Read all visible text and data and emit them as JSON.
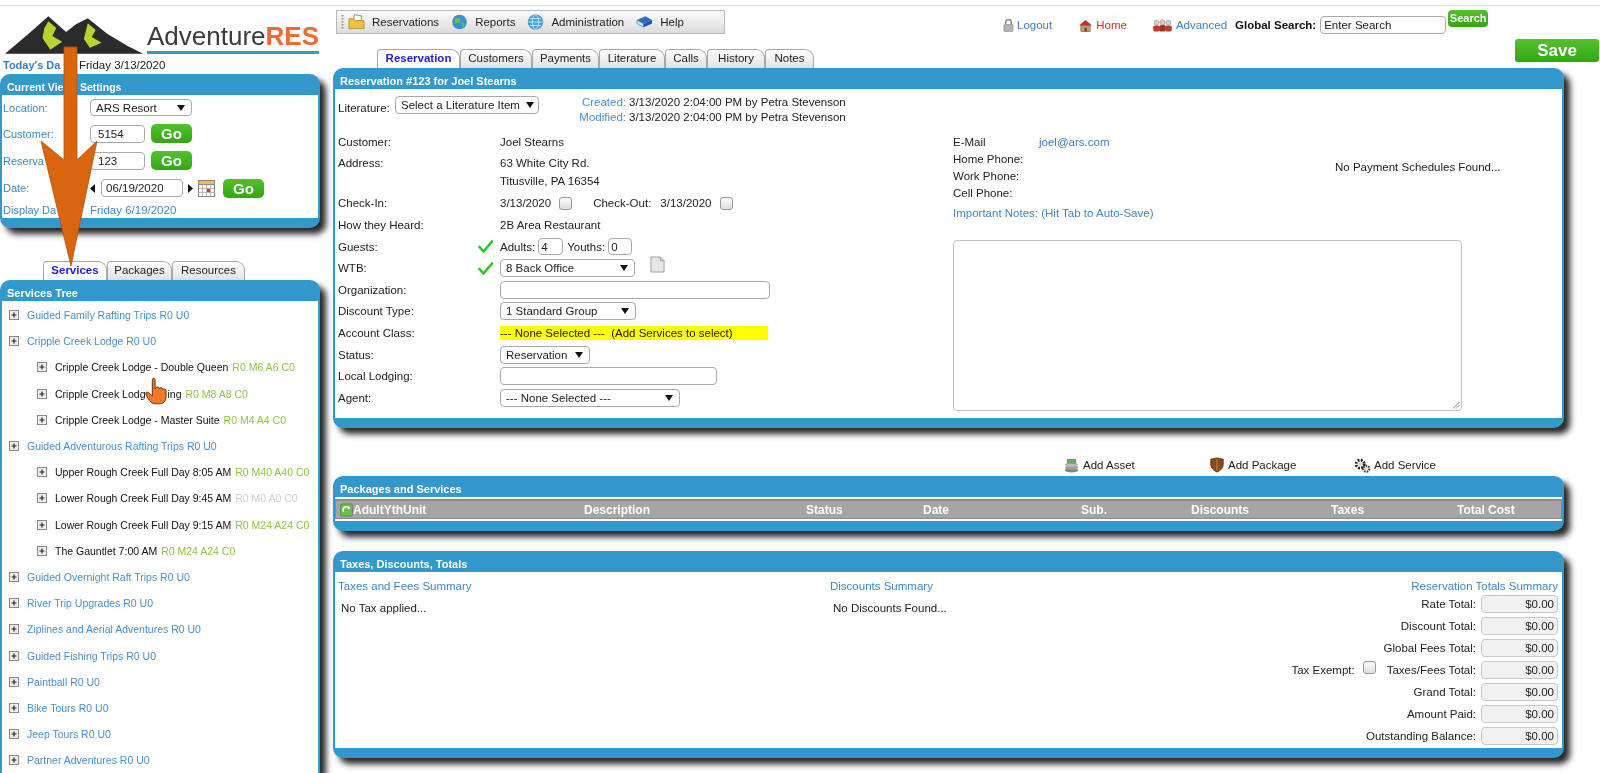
{
  "logo": {
    "wordmark": "Adventure**RES**"
  },
  "today": {
    "label": "Today's Da",
    "value": "Friday 3/13/2020"
  },
  "view_settings": {
    "title": "Current Vie",
    "title_tail": "Settings",
    "fields": [
      {
        "kind": "select",
        "label": "Location:",
        "value": "ARS Resort"
      },
      {
        "kind": "input_go",
        "label": "Customer:",
        "value": "5154",
        "button": "Go"
      },
      {
        "kind": "input_go",
        "label": "Reserva",
        "value": "123",
        "button": "Go"
      },
      {
        "kind": "date",
        "label": "Date:",
        "value": "06/19/2020",
        "button": "Go"
      },
      {
        "kind": "text",
        "label": "Display Da",
        "value": "Friday 6/19/2020"
      }
    ]
  },
  "side_tabs": [
    {
      "label": "Services",
      "selected": true
    },
    {
      "label": "Packages",
      "selected": false
    },
    {
      "label": "Resources",
      "selected": false
    }
  ],
  "services_tree": {
    "title": "Services Tree",
    "items": [
      {
        "label": "Guided Family Rafting Trips R0 U0"
      },
      {
        "label": "Cripple Creek Lodge R0 U0",
        "children": [
          {
            "label": "Cripple Creek Lodge - Double Queen",
            "counts": "R0 M6 A6 C0",
            "color": "#8dc63f"
          },
          {
            "label": "Cripple Creek Lodg",
            "label_tail": "ing",
            "counts": "R0 M8 A8 C0",
            "color": "#8dc63f"
          },
          {
            "label": "Cripple Creek Lodge - Master Suite",
            "counts": "R0 M4 A4 C0",
            "color": "#8dc63f"
          }
        ]
      },
      {
        "label": "Guided Adventurous Rafting Trips R0 U0",
        "children": [
          {
            "label": "Upper Rough Creek Full Day 8:05 AM",
            "counts": "R0 M40 A40 C0",
            "color": "#8dc63f"
          },
          {
            "label": "Lower Rough Creek Full Day 9:45 AM",
            "counts": "R0 M0 A0 C0",
            "color": "#cfcfcf"
          },
          {
            "label": "Lower Rough Creek Full Day 9:15 AM",
            "counts": "R0 M24 A24 C0",
            "color": "#8dc63f"
          },
          {
            "label": "The Gauntlet 7:00 AM",
            "counts": "R0 M24 A24 C0",
            "color": "#8dc63f"
          }
        ]
      },
      {
        "label": "Guided Overnight Raft Trips R0 U0"
      },
      {
        "label": "River Trip Upgrades R0 U0"
      },
      {
        "label": "Ziplines and Aerial Adventures R0 U0"
      },
      {
        "label": "Guided Fishing Trips R0 U0"
      },
      {
        "label": "Paintball R0 U0"
      },
      {
        "label": "Bike Tours R0 U0"
      },
      {
        "label": "Jeep Tours R0 U0"
      },
      {
        "label": "Partner Adventures R0 U0"
      }
    ]
  },
  "main_menu": [
    {
      "label": "Reservations"
    },
    {
      "label": "Reports"
    },
    {
      "label": "Administration"
    },
    {
      "label": "Help"
    }
  ],
  "top_links": [
    {
      "label": "Logout",
      "color": "#3a7fc4"
    },
    {
      "label": "Home",
      "color": "#e8281e"
    },
    {
      "label": "Advanced",
      "color": "#3a7fc4"
    }
  ],
  "global_search": {
    "label": "Global Search:",
    "value": "Enter Search",
    "button": "Search"
  },
  "save_button": "Save",
  "main_tabs": [
    {
      "label": "Reservation",
      "selected": true
    },
    {
      "label": "Customers",
      "selected": false
    },
    {
      "label": "Payments",
      "selected": false
    },
    {
      "label": "Literature",
      "selected": false
    },
    {
      "label": "Calls",
      "selected": false
    },
    {
      "label": "History",
      "selected": false
    },
    {
      "label": "Notes",
      "selected": false
    }
  ],
  "reservation": {
    "title": "Reservation #123 for Joel Stearns",
    "literature": {
      "label": "Literature:",
      "value": "Select a Literature Item"
    },
    "audit": [
      {
        "label": "Created:",
        "value": "3/13/2020 2:04:00 PM by Petra Stevenson"
      },
      {
        "label": "Modified:",
        "value": "3/13/2020 2:04:00 PM by Petra Stevenson"
      }
    ],
    "fields": [
      {
        "kind": "text",
        "label": "Customer:",
        "value": "Joel Stearns"
      },
      {
        "kind": "lines",
        "label": "Address:",
        "lines": [
          "63 White City Rd.",
          "Titusville, PA 16354"
        ]
      },
      {
        "kind": "checkdates",
        "label": "Check-In:",
        "value": "3/13/2020",
        "checked": false,
        "second_label": "Check-Out:",
        "second_value": "3/13/2020",
        "second_checked": false
      },
      {
        "kind": "text",
        "label": "How they Heard:",
        "value": "2B Area Restaurant"
      },
      {
        "kind": "guests",
        "label": "Guests:",
        "valid": true,
        "adults_label": "Adults:",
        "adults": "4",
        "youths_label": "Youths:",
        "youths": "0"
      },
      {
        "kind": "select",
        "label": "WTB:",
        "valid": true,
        "value": "8 Back Office",
        "note": true
      },
      {
        "kind": "input",
        "label": "Organization:"
      },
      {
        "kind": "select",
        "label": "Discount Type:",
        "value": "1 Standard Group"
      },
      {
        "kind": "highlight",
        "label": "Account Class:",
        "value": "--- None Selected ---  (Add Services to select)"
      },
      {
        "kind": "select",
        "label": "Status:",
        "value": "Reservation"
      },
      {
        "kind": "input",
        "label": "Local Lodging:"
      },
      {
        "kind": "select",
        "label": "Agent:",
        "value": "--- None Selected ---"
      }
    ],
    "contact": [
      {
        "label": "E-Mail",
        "value": "joel@ars.com"
      },
      {
        "label": "Home Phone:"
      },
      {
        "label": "Work Phone:"
      },
      {
        "label": "Cell Phone:"
      }
    ],
    "payment_schedules": "No Payment Schedules Found...",
    "notes": {
      "label": "Important Notes: (Hit Tab to Auto-Save)"
    }
  },
  "actions": [
    {
      "label": "Add Asset"
    },
    {
      "label": "Add Package"
    },
    {
      "label": "Add Service"
    }
  ],
  "packages": {
    "title": "Packages and Services",
    "columns": [
      "AdultYthUnit",
      "Description",
      "Status",
      "Date",
      "Sub.",
      "Discounts",
      "Taxes",
      "Total Cost"
    ]
  },
  "totals": {
    "title": "Taxes, Discounts, Totals",
    "taxes": {
      "title": "Taxes and Fees Summary",
      "text": "No Tax applied..."
    },
    "discounts": {
      "title": "Discounts Summary",
      "text": "No Discounts Found..."
    },
    "summary": {
      "title": "Reservation Totals Summary",
      "rows": [
        {
          "label": "Rate Total:",
          "value": "$0.00"
        },
        {
          "label": "Discount Total:",
          "value": "$0.00"
        },
        {
          "label": "Global Fees Total:",
          "value": "$0.00"
        },
        {
          "label": "Taxes/Fees Total:",
          "value": "$0.00",
          "extra": {
            "label": "Tax Exempt:",
            "checked": false
          }
        },
        {
          "label": "Grand Total:",
          "value": "$0.00"
        },
        {
          "label": "Amount Paid:",
          "value": "$0.00"
        },
        {
          "label": "Outstanding Balance:",
          "value": "$0.00"
        }
      ]
    }
  }
}
